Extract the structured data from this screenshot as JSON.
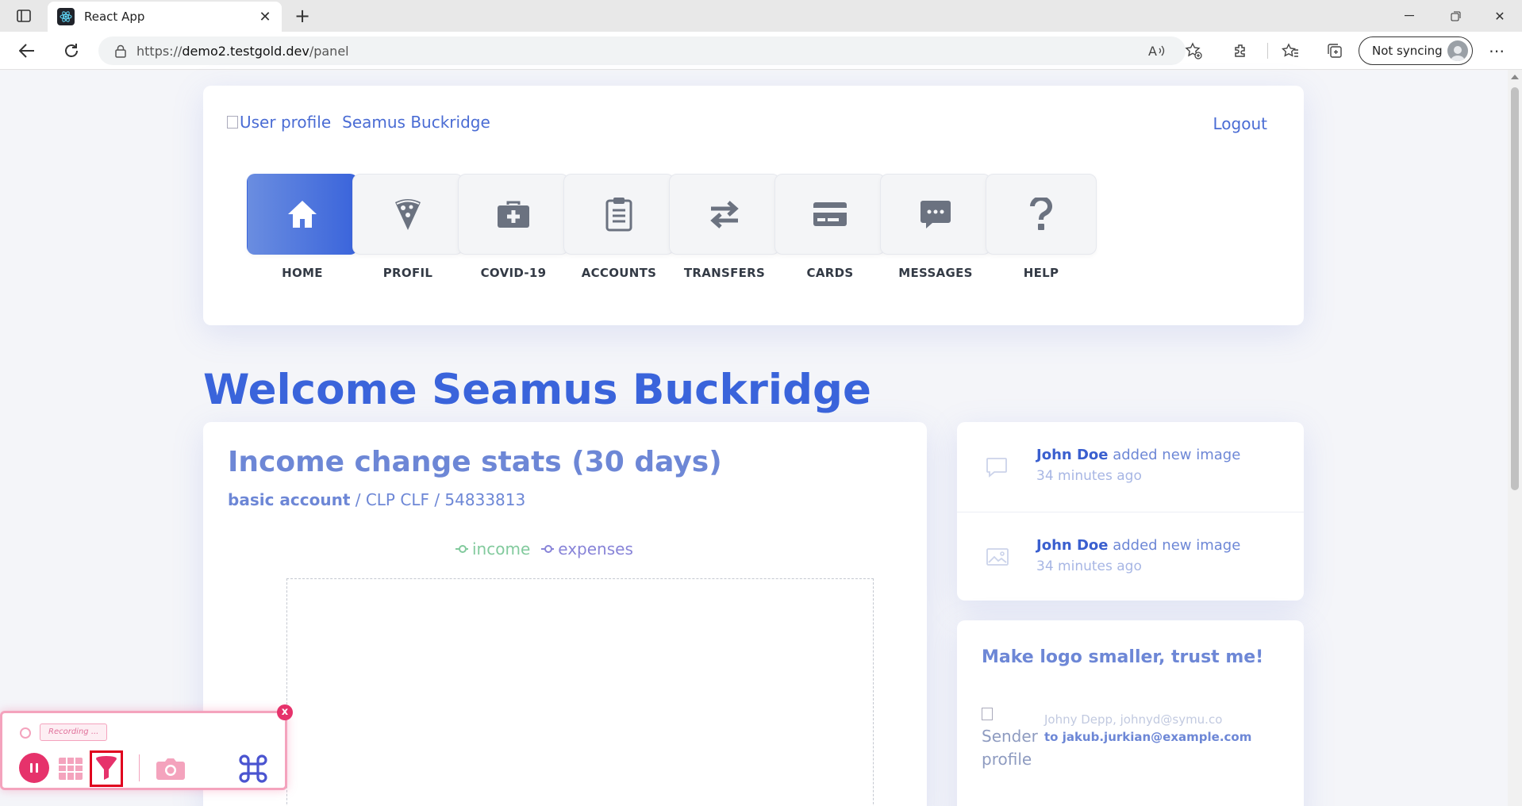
{
  "browser": {
    "tab_title": "React App",
    "url_prefix": "https://",
    "url_host": "demo2.testgold.dev",
    "url_path": "/panel",
    "sync_label": "Not syncing"
  },
  "header": {
    "profile_alt": "User profile",
    "user_name": "Seamus Buckridge",
    "logout_label": "Logout"
  },
  "nav": {
    "items": [
      {
        "label": "HOME",
        "icon": "home-icon",
        "active": true
      },
      {
        "label": "PROFIL",
        "icon": "pizza-icon"
      },
      {
        "label": "COVID-19",
        "icon": "medkit-icon"
      },
      {
        "label": "ACCOUNTS",
        "icon": "clipboard-icon"
      },
      {
        "label": "TRANSFERS",
        "icon": "transfer-arrows-icon"
      },
      {
        "label": "CARDS",
        "icon": "credit-card-icon"
      },
      {
        "label": "MESSAGES",
        "icon": "chat-bubble-icon"
      },
      {
        "label": "HELP",
        "icon": "question-mark-icon"
      }
    ]
  },
  "welcome": "Welcome Seamus Buckridge",
  "stats": {
    "title": "Income change stats (30 days)",
    "account_type": "basic account",
    "account_rest": " / CLP CLF / 54833813",
    "legend": [
      {
        "name": "income",
        "color": "#82ca9d"
      },
      {
        "name": "expenses",
        "color": "#8884d8"
      }
    ]
  },
  "activity": [
    {
      "user": "John Doe",
      "action": " added new image",
      "time": "34 minutes ago",
      "icon": "comment-icon"
    },
    {
      "user": "John Doe",
      "action": " added new image",
      "time": "34 minutes ago",
      "icon": "image-icon"
    }
  ],
  "message": {
    "title": "Make logo smaller, trust me!",
    "sender_alt": "Sender profile",
    "sender": "Johny Depp, johnyd@symu.co",
    "to": "to jakub.jurkian@example.com"
  },
  "recorder": {
    "status": "Recording ...",
    "close_label": "x"
  },
  "colors": {
    "accent": "#3a64db",
    "accent_light": "#6d87d6",
    "recorder_pink": "#e6326b"
  }
}
